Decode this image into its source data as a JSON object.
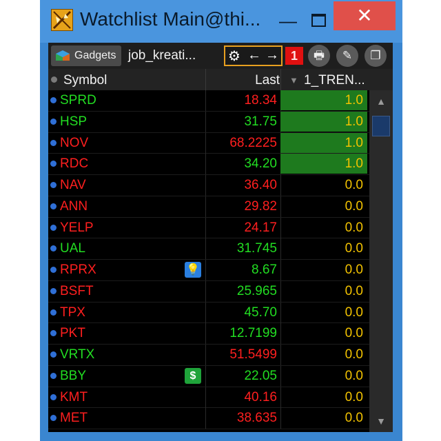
{
  "window": {
    "title": "Watchlist Main@thi...",
    "controls": {
      "minimize": "—",
      "close": "✕"
    }
  },
  "toolbar": {
    "gadgets_label": "Gadgets",
    "job_tab_label": "job_kreati...",
    "tools": {
      "gear": "⚙",
      "left": "←",
      "right": "→"
    },
    "badge": "1",
    "print": "🖶",
    "pin": "✎",
    "copy": "❐"
  },
  "columns": {
    "symbol": "Symbol",
    "last": "Last",
    "trend": "1_TREN...",
    "sort_indicator": "▼"
  },
  "colors": {
    "up": "#22dd22",
    "down": "#ff1f1f",
    "trend_value": "#f2c200",
    "trend_highlight": "#1e7a1e"
  },
  "rows": [
    {
      "symbol": "SPRD",
      "symbol_color": "green",
      "last": "18.34",
      "last_color": "red",
      "trend": "1.0",
      "trend_highlight": true
    },
    {
      "symbol": "HSP",
      "symbol_color": "green",
      "last": "31.75",
      "last_color": "green",
      "trend": "1.0",
      "trend_highlight": true
    },
    {
      "symbol": "NOV",
      "symbol_color": "red",
      "last": "68.2225",
      "last_color": "red",
      "trend": "1.0",
      "trend_highlight": true
    },
    {
      "symbol": "RDC",
      "symbol_color": "red",
      "last": "34.20",
      "last_color": "green",
      "trend": "1.0",
      "trend_highlight": true
    },
    {
      "symbol": "NAV",
      "symbol_color": "red",
      "last": "36.40",
      "last_color": "red",
      "trend": "0.0",
      "trend_highlight": false
    },
    {
      "symbol": "ANN",
      "symbol_color": "red",
      "last": "29.82",
      "last_color": "red",
      "trend": "0.0",
      "trend_highlight": false
    },
    {
      "symbol": "YELP",
      "symbol_color": "red",
      "last": "24.17",
      "last_color": "red",
      "trend": "0.0",
      "trend_highlight": false
    },
    {
      "symbol": "UAL",
      "symbol_color": "green",
      "last": "31.745",
      "last_color": "green",
      "trend": "0.0",
      "trend_highlight": false
    },
    {
      "symbol": "RPRX",
      "symbol_color": "red",
      "last": "8.67",
      "last_color": "green",
      "trend": "0.0",
      "trend_highlight": false,
      "icon": "lightbulb-icon",
      "icon_glyph": "💡",
      "icon_bg": "#2a7fe0"
    },
    {
      "symbol": "BSFT",
      "symbol_color": "red",
      "last": "25.965",
      "last_color": "green",
      "trend": "0.0",
      "trend_highlight": false
    },
    {
      "symbol": "TPX",
      "symbol_color": "red",
      "last": "45.70",
      "last_color": "green",
      "trend": "0.0",
      "trend_highlight": false
    },
    {
      "symbol": "PKT",
      "symbol_color": "red",
      "last": "12.7199",
      "last_color": "green",
      "trend": "0.0",
      "trend_highlight": false
    },
    {
      "symbol": "VRTX",
      "symbol_color": "green",
      "last": "51.5499",
      "last_color": "red",
      "trend": "0.0",
      "trend_highlight": false
    },
    {
      "symbol": "BBY",
      "symbol_color": "green",
      "last": "22.05",
      "last_color": "green",
      "trend": "0.0",
      "trend_highlight": false,
      "icon": "dollar-icon",
      "icon_glyph": "$",
      "icon_bg": "#1fa33a"
    },
    {
      "symbol": "KMT",
      "symbol_color": "red",
      "last": "40.16",
      "last_color": "red",
      "trend": "0.0",
      "trend_highlight": false
    },
    {
      "symbol": "MET",
      "symbol_color": "red",
      "last": "38.635",
      "last_color": "red",
      "trend": "0.0",
      "trend_highlight": false
    }
  ],
  "scrollbar": {
    "up": "▲",
    "down": "▼"
  }
}
